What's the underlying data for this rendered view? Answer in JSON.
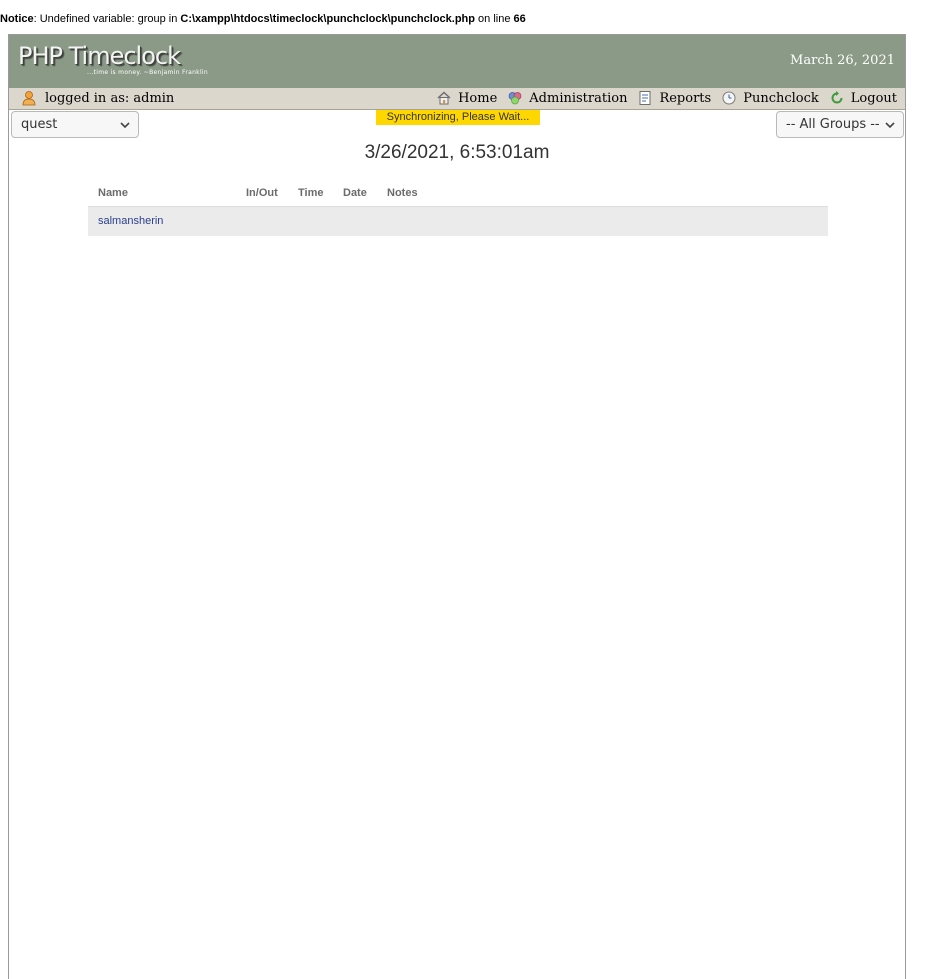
{
  "notice": {
    "label": "Notice",
    "message": ": Undefined variable: group in ",
    "path": "C:\\xampp\\htdocs\\timeclock\\punchclock\\punchclock.php",
    "on_line": " on line ",
    "line": "66"
  },
  "header": {
    "logo": "PHP Timeclock",
    "tagline": "...time is money.   ~Benjamin Franklin",
    "date": "March 26, 2021"
  },
  "navbar": {
    "login_text": "logged in as: admin",
    "menu": [
      {
        "label": "Home",
        "icon": "home-icon"
      },
      {
        "label": "Administration",
        "icon": "admin-icon"
      },
      {
        "label": "Reports",
        "icon": "report-icon"
      },
      {
        "label": "Punchclock",
        "icon": "clock-icon"
      },
      {
        "label": "Logout",
        "icon": "logout-icon"
      }
    ]
  },
  "controls": {
    "group_select": "quest",
    "all_groups_select": "-- All Groups --"
  },
  "status": {
    "sync": "Synchronizing, Please Wait..."
  },
  "clock": "3/26/2021, 6:53:01am",
  "table": {
    "headers": [
      "Name",
      "In/Out",
      "Time",
      "Date",
      "Notes"
    ],
    "rows": [
      {
        "name": "salmansherin",
        "in_out": "",
        "time": "",
        "date": "",
        "notes": ""
      }
    ]
  },
  "colors": {
    "header_bg": "#8a9a86",
    "navbar_bg": "#dcd7cc",
    "sync_bg": "#ffd700",
    "row_bg": "#ebebeb"
  }
}
